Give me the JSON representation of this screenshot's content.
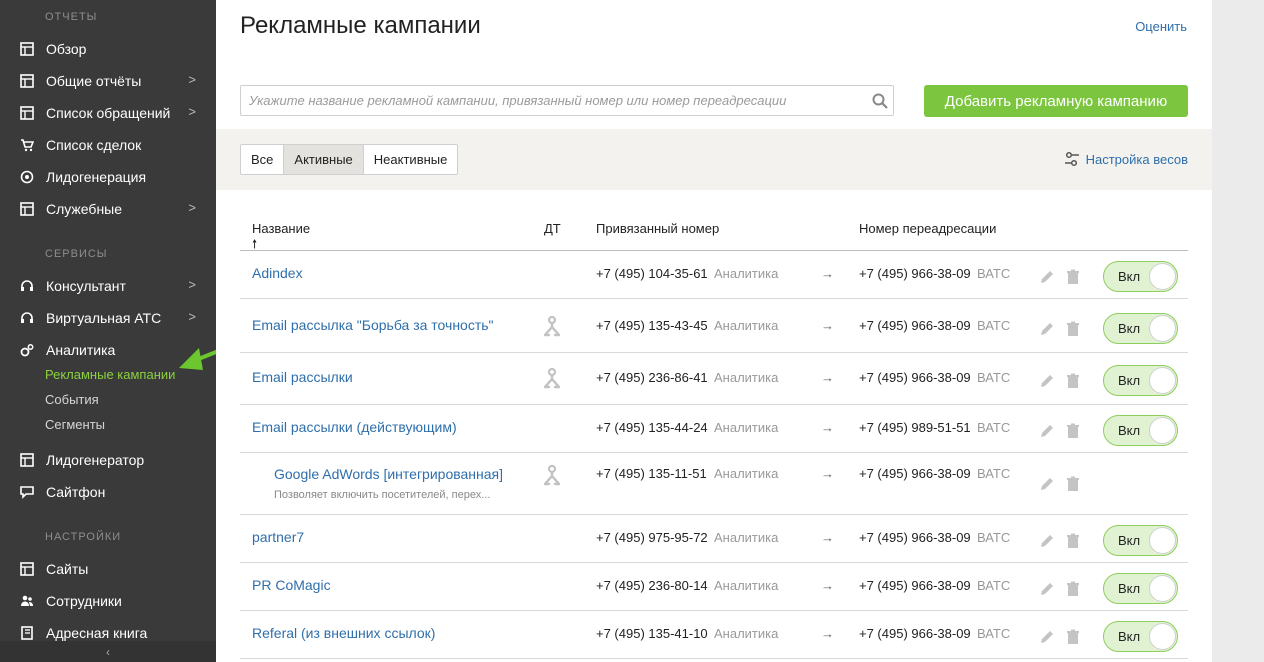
{
  "sidebar": {
    "sections": {
      "reports": "ОТЧЕТЫ",
      "services": "СЕРВИСЫ",
      "settings": "НАСТРОЙКИ"
    },
    "items": {
      "overview": "Обзор",
      "general": "Общие отчёты",
      "requests": "Список обращений",
      "deals": "Список сделок",
      "leadgen": "Лидогенерация",
      "service": "Служебные",
      "consultant": "Консультант",
      "vats": "Виртуальная АТС",
      "analytics": "Аналитика",
      "leadgenerator": "Лидогенератор",
      "sitephone": "Сайтфон",
      "sites": "Сайты",
      "employees": "Сотрудники",
      "addressbook": "Адресная книга"
    },
    "chevron": ">",
    "sub": {
      "campaigns": "Рекламные кампании",
      "events": "События",
      "segments": "Сегменты"
    },
    "collapse": "‹"
  },
  "page": {
    "title": "Рекламные кампании",
    "rate": "Оценить"
  },
  "search": {
    "placeholder": "Укажите название рекламной кампании, привязанный номер или номер переадресации"
  },
  "add_button": "Добавить рекламную кампанию",
  "tabs": {
    "all": "Все",
    "active": "Активные",
    "inactive": "Неактивные"
  },
  "weights": "Настройка весов",
  "table": {
    "headers": {
      "name": "Название",
      "dt": "ДТ",
      "number": "Привязанный номер",
      "forward": "Номер переадресации"
    },
    "sort_arrow": "🠕",
    "rows": [
      {
        "name": "Adindex",
        "desc": "",
        "dt": false,
        "number": "+7 (495) 104-35-61",
        "number_tag": "Аналитика",
        "arrow": "→",
        "forward": "+7 (495) 966-38-09",
        "forward_tag": "ВАТС",
        "toggle": "Вкл"
      },
      {
        "name": "Email рассылка \"Борьба за точность\"",
        "desc": "",
        "dt": true,
        "number": "+7 (495) 135-43-45",
        "number_tag": "Аналитика",
        "arrow": "→",
        "forward": "+7 (495) 966-38-09",
        "forward_tag": "ВАТС",
        "toggle": "Вкл"
      },
      {
        "name": "Email рассылки",
        "desc": "",
        "dt": true,
        "number": "+7 (495) 236-86-41",
        "number_tag": "Аналитика",
        "arrow": "→",
        "forward": "+7 (495) 966-38-09",
        "forward_tag": "ВАТС",
        "toggle": "Вкл"
      },
      {
        "name": "Email рассылки (действующим)",
        "desc": "",
        "dt": false,
        "number": "+7 (495) 135-44-24",
        "number_tag": "Аналитика",
        "arrow": "→",
        "forward": "+7 (495) 989-51-51",
        "forward_tag": "ВАТС",
        "toggle": "Вкл"
      },
      {
        "name": "Google AdWords [интегрированная]",
        "desc": "Позволяет включить посетителей, перех...",
        "dt": true,
        "number": "+7 (495) 135-11-51",
        "number_tag": "Аналитика",
        "arrow": "→",
        "forward": "+7 (495) 966-38-09",
        "forward_tag": "ВАТС",
        "toggle": ""
      },
      {
        "name": "partner7",
        "desc": "",
        "dt": false,
        "number": "+7 (495) 975-95-72",
        "number_tag": "Аналитика",
        "arrow": "→",
        "forward": "+7 (495) 966-38-09",
        "forward_tag": "ВАТС",
        "toggle": "Вкл"
      },
      {
        "name": "PR CoMagic",
        "desc": "",
        "dt": false,
        "number": "+7 (495) 236-80-14",
        "number_tag": "Аналитика",
        "arrow": "→",
        "forward": "+7 (495) 966-38-09",
        "forward_tag": "ВАТС",
        "toggle": "Вкл"
      },
      {
        "name": "Referal (из внешних ссылок)",
        "desc": "",
        "dt": false,
        "number": "+7 (495) 135-41-10",
        "number_tag": "Аналитика",
        "arrow": "→",
        "forward": "+7 (495) 966-38-09",
        "forward_tag": "ВАТС",
        "toggle": "Вкл"
      }
    ]
  },
  "colors": {
    "accent_green": "#7bc63e",
    "link_blue": "#2f6fab",
    "sidebar_bg": "#3a3a3a",
    "active_sub": "#8bd13e"
  }
}
